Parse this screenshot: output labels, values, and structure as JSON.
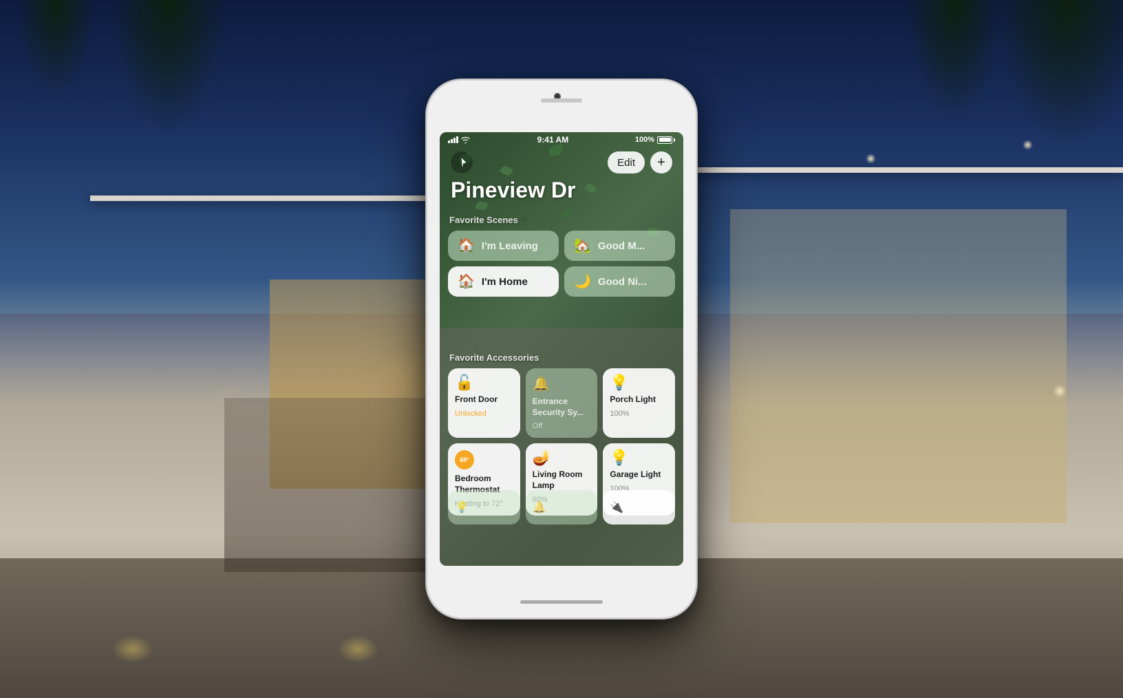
{
  "background": {
    "alt": "Modern house exterior at night with warm lighting"
  },
  "phone": {
    "status_bar": {
      "signal": "●●●●",
      "wifi": "wifi",
      "time": "9:41 AM",
      "battery_percent": "100%",
      "battery_icon": "battery"
    },
    "app": {
      "title": "Pineview Dr",
      "location_button_label": "⇗",
      "edit_button": "Edit",
      "add_button": "+",
      "sections": {
        "scenes_label": "Favorite Scenes",
        "accessories_label": "Favorite Accessories"
      },
      "scenes": [
        {
          "id": "im-leaving",
          "name": "I'm Leaving",
          "icon": "🏠",
          "active": false
        },
        {
          "id": "good-morning",
          "name": "Good M...",
          "icon": "🏡",
          "active": false
        },
        {
          "id": "im-home",
          "name": "I'm Home",
          "icon": "🏠",
          "active": true
        },
        {
          "id": "good-night",
          "name": "Good Ni...",
          "icon": "🌙",
          "active": false
        }
      ],
      "accessories": [
        {
          "id": "front-door",
          "name": "Front Door",
          "status": "Unlocked",
          "status_type": "unlocked",
          "icon": "🔓",
          "active": true
        },
        {
          "id": "entrance-security",
          "name": "Entrance Security Sy...",
          "status": "Off",
          "status_type": "off",
          "icon": "🔔",
          "active": false
        },
        {
          "id": "porch-light",
          "name": "Porch Light",
          "status": "100%",
          "status_type": "on",
          "icon": "💡",
          "active": true
        },
        {
          "id": "bedroom-thermostat",
          "name": "Bedroom Thermostat",
          "status": "Heating to 72°",
          "status_type": "heating",
          "icon": "68°",
          "active": true,
          "is_thermostat": true
        },
        {
          "id": "living-room-lamp",
          "name": "Living Room Lamp",
          "status": "60%",
          "status_type": "on",
          "icon": "🪔",
          "active": true
        },
        {
          "id": "garage-light",
          "name": "Garage Light",
          "status": "100%",
          "status_type": "on",
          "icon": "💡",
          "active": true
        }
      ],
      "row3_accessories": [
        {
          "id": "row3-item1",
          "name": "",
          "active": false
        },
        {
          "id": "row3-item2",
          "name": "",
          "active": false
        },
        {
          "id": "row3-item3",
          "name": "",
          "active": false
        }
      ]
    }
  }
}
